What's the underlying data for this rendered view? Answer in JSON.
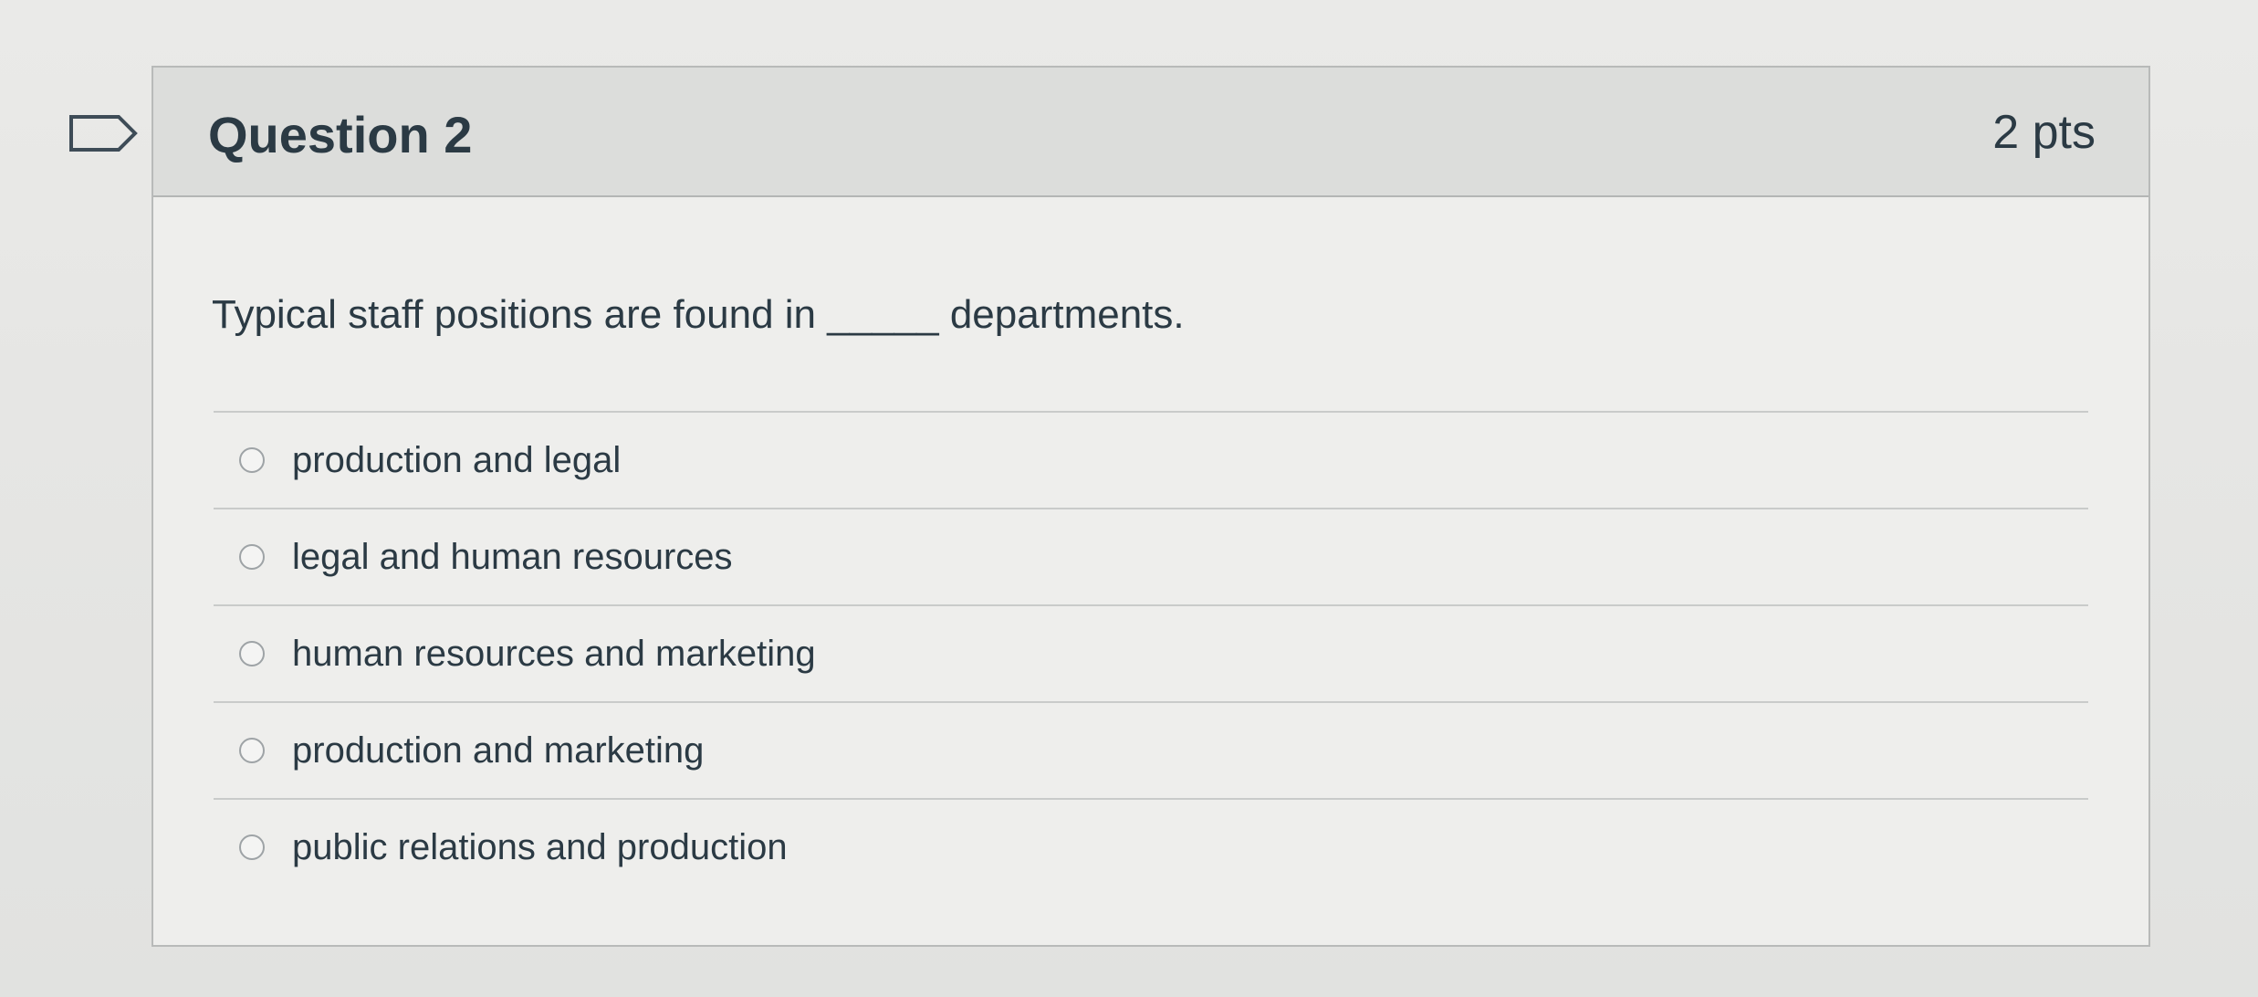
{
  "question": {
    "title": "Question 2",
    "points": "2 pts",
    "text": "Typical staff positions are found in _____ departments."
  },
  "answers": [
    {
      "label": "production and legal"
    },
    {
      "label": "legal and human resources"
    },
    {
      "label": "human resources and marketing"
    },
    {
      "label": "production and marketing"
    },
    {
      "label": "public relations and production"
    }
  ],
  "flag_icon": "flag-icon"
}
